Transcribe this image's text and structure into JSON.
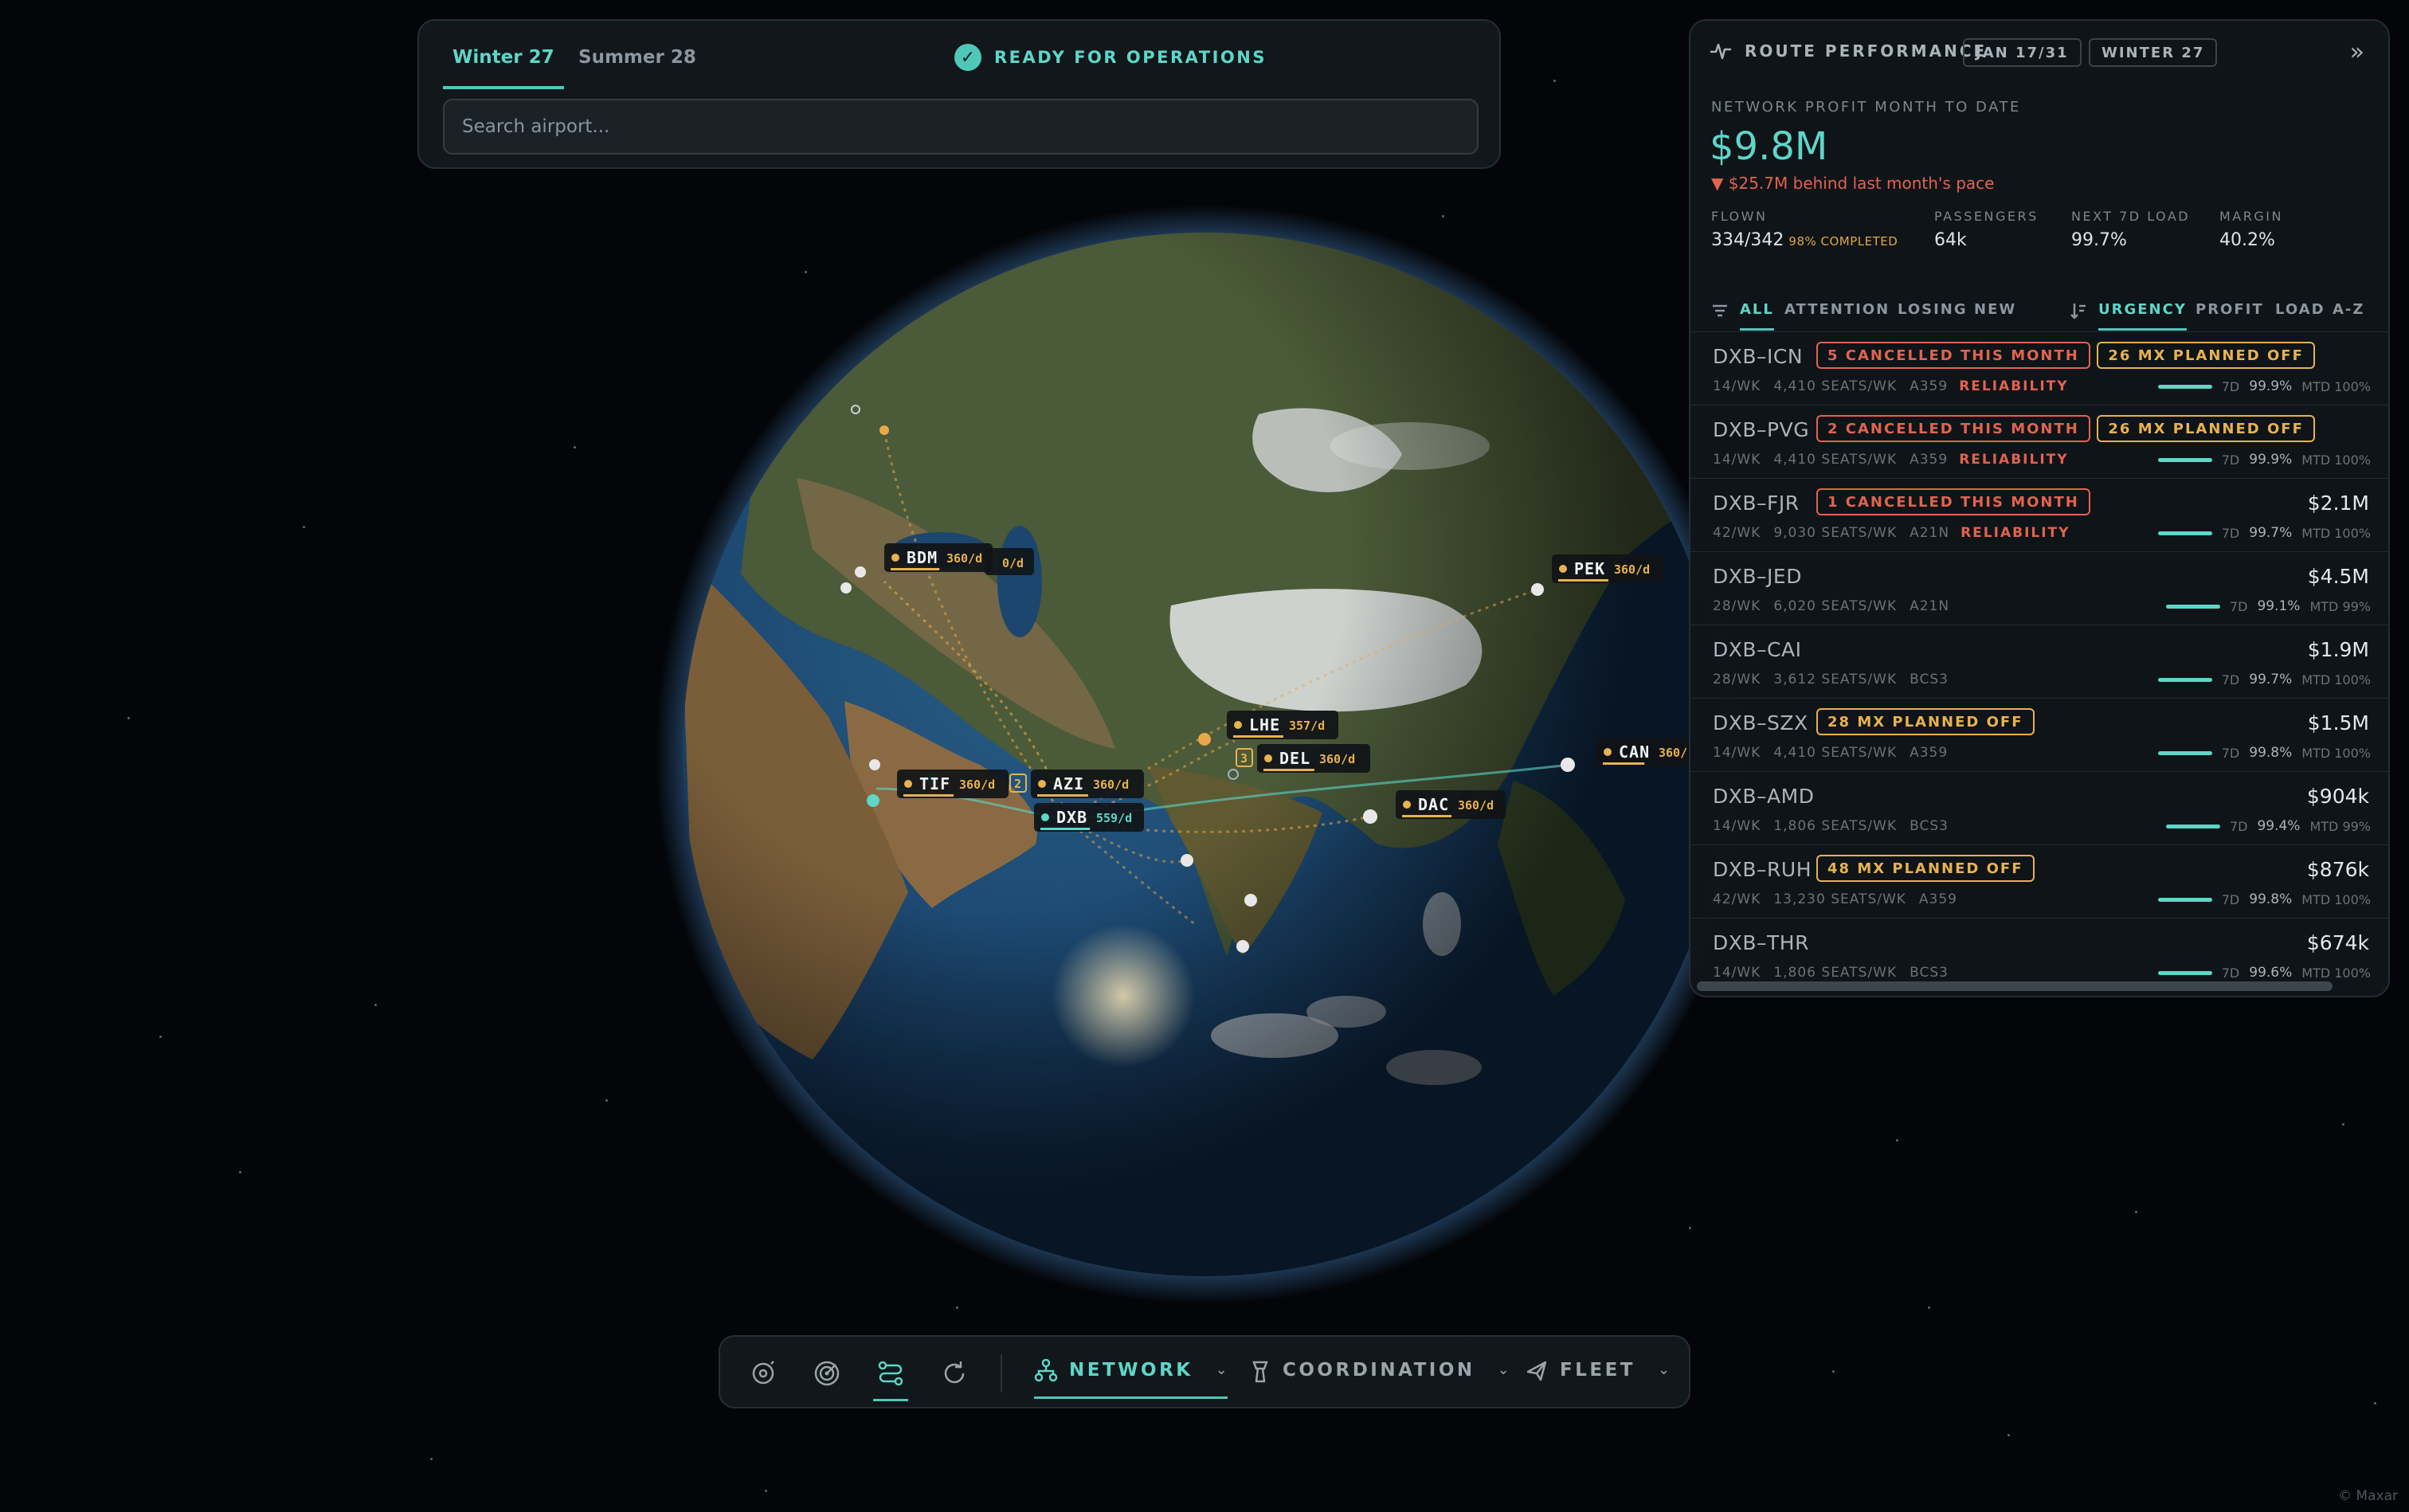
{
  "top_panel": {
    "tabs": [
      {
        "label": "Winter 27",
        "active": true
      },
      {
        "label": "Summer 28",
        "active": false
      }
    ],
    "status": "READY FOR OPERATIONS",
    "search": {
      "placeholder": "Search airport...",
      "value": ""
    }
  },
  "route_panel": {
    "title": "ROUTE PERFORMANCE",
    "date_chip": "JAN 17/31",
    "season_chip": "WINTER 27",
    "profit_caption": "NETWORK PROFIT MONTH TO DATE",
    "profit_value": "$9.8M",
    "pace_text": "$25.7M behind last month's pace",
    "kpis": [
      {
        "label": "FLOWN",
        "value": "334/342",
        "sub": "98% COMPLETED"
      },
      {
        "label": "PASSENGERS",
        "value": "64k"
      },
      {
        "label": "NEXT 7D LOAD",
        "value": "99.7%"
      },
      {
        "label": "MARGIN",
        "value": "40.2%"
      }
    ],
    "filters": [
      "ALL",
      "ATTENTION",
      "LOSING",
      "NEW"
    ],
    "active_filter": "ALL",
    "sorts": [
      "URGENCY",
      "PROFIT",
      "LOAD",
      "A-Z"
    ],
    "active_sort": "URGENCY",
    "routes": [
      {
        "name": "DXB–ICN",
        "freq": "14/WK",
        "seats": "4,410 SEATS/WK",
        "aircraft": "A359",
        "flag": "RELIABILITY",
        "badges": [
          {
            "text": "5 CANCELLED THIS MONTH",
            "tone": "red"
          },
          {
            "text": "26 MX PLANNED OFF",
            "tone": "amber"
          }
        ],
        "profit": "",
        "window": "7D",
        "load": "99.9%",
        "mtd": "MTD 100%"
      },
      {
        "name": "DXB–PVG",
        "freq": "14/WK",
        "seats": "4,410 SEATS/WK",
        "aircraft": "A359",
        "flag": "RELIABILITY",
        "badges": [
          {
            "text": "2 CANCELLED THIS MONTH",
            "tone": "red"
          },
          {
            "text": "26 MX PLANNED OFF",
            "tone": "amber"
          }
        ],
        "profit": "",
        "window": "7D",
        "load": "99.9%",
        "mtd": "MTD 100%"
      },
      {
        "name": "DXB–FJR",
        "freq": "42/WK",
        "seats": "9,030 SEATS/WK",
        "aircraft": "A21N",
        "flag": "RELIABILITY",
        "badges": [
          {
            "text": "1 CANCELLED THIS MONTH",
            "tone": "red"
          }
        ],
        "profit": "$2.1M",
        "window": "7D",
        "load": "99.7%",
        "mtd": "MTD 100%"
      },
      {
        "name": "DXB–JED",
        "freq": "28/WK",
        "seats": "6,020 SEATS/WK",
        "aircraft": "A21N",
        "flag": "",
        "badges": [],
        "profit": "$4.5M",
        "window": "7D",
        "load": "99.1%",
        "mtd": "MTD 99%"
      },
      {
        "name": "DXB–CAI",
        "freq": "28/WK",
        "seats": "3,612 SEATS/WK",
        "aircraft": "BCS3",
        "flag": "",
        "badges": [],
        "profit": "$1.9M",
        "window": "7D",
        "load": "99.7%",
        "mtd": "MTD 100%"
      },
      {
        "name": "DXB–SZX",
        "freq": "14/WK",
        "seats": "4,410 SEATS/WK",
        "aircraft": "A359",
        "flag": "",
        "badges": [
          {
            "text": "28 MX PLANNED OFF",
            "tone": "amber"
          }
        ],
        "profit": "$1.5M",
        "window": "7D",
        "load": "99.8%",
        "mtd": "MTD 100%"
      },
      {
        "name": "DXB–AMD",
        "freq": "14/WK",
        "seats": "1,806 SEATS/WK",
        "aircraft": "BCS3",
        "flag": "",
        "badges": [],
        "profit": "$904k",
        "window": "7D",
        "load": "99.4%",
        "mtd": "MTD 99%"
      },
      {
        "name": "DXB–RUH",
        "freq": "42/WK",
        "seats": "13,230 SEATS/WK",
        "aircraft": "A359",
        "flag": "",
        "badges": [
          {
            "text": "48 MX PLANNED OFF",
            "tone": "amber"
          }
        ],
        "profit": "$876k",
        "window": "7D",
        "load": "99.8%",
        "mtd": "MTD 100%"
      },
      {
        "name": "DXB–THR",
        "freq": "14/WK",
        "seats": "1,806 SEATS/WK",
        "aircraft": "BCS3",
        "flag": "",
        "badges": [],
        "profit": "$674k",
        "window": "7D",
        "load": "99.6%",
        "mtd": "MTD 100%"
      }
    ]
  },
  "map": {
    "airports": [
      {
        "code": "BDM",
        "freq": "360/d",
        "tone": "amber"
      },
      {
        "code": "PEK",
        "freq": "360/d",
        "tone": "amber"
      },
      {
        "code": "LHE",
        "freq": "357/d",
        "tone": "amber"
      },
      {
        "code": "DEL",
        "freq": "360/d",
        "tone": "amber",
        "cluster": "3"
      },
      {
        "code": "TIF",
        "freq": "360/d",
        "tone": "amber"
      },
      {
        "code": "AZI",
        "freq": "360/d",
        "tone": "amber",
        "cluster": "2"
      },
      {
        "code": "DXB",
        "freq": "559/d",
        "tone": "cyan"
      },
      {
        "code": "DAC",
        "freq": "360/d",
        "tone": "amber"
      },
      {
        "code": "CAN",
        "freq": "360/",
        "tone": "amber"
      }
    ],
    "overlapped_label": "0/d"
  },
  "toolbar": {
    "icons": [
      "orbit-icon",
      "radar-icon",
      "routes-icon",
      "refresh-icon"
    ],
    "active_icon": "routes-icon",
    "modes": [
      {
        "label": "NETWORK",
        "active": true
      },
      {
        "label": "COORDINATION",
        "active": false
      },
      {
        "label": "FLEET",
        "active": false
      }
    ]
  },
  "attribution": "© Maxar",
  "colors": {
    "accent": "#5ed6c8",
    "alert": "#e2634f",
    "warning": "#e8b24e",
    "panel": "#10151a"
  }
}
